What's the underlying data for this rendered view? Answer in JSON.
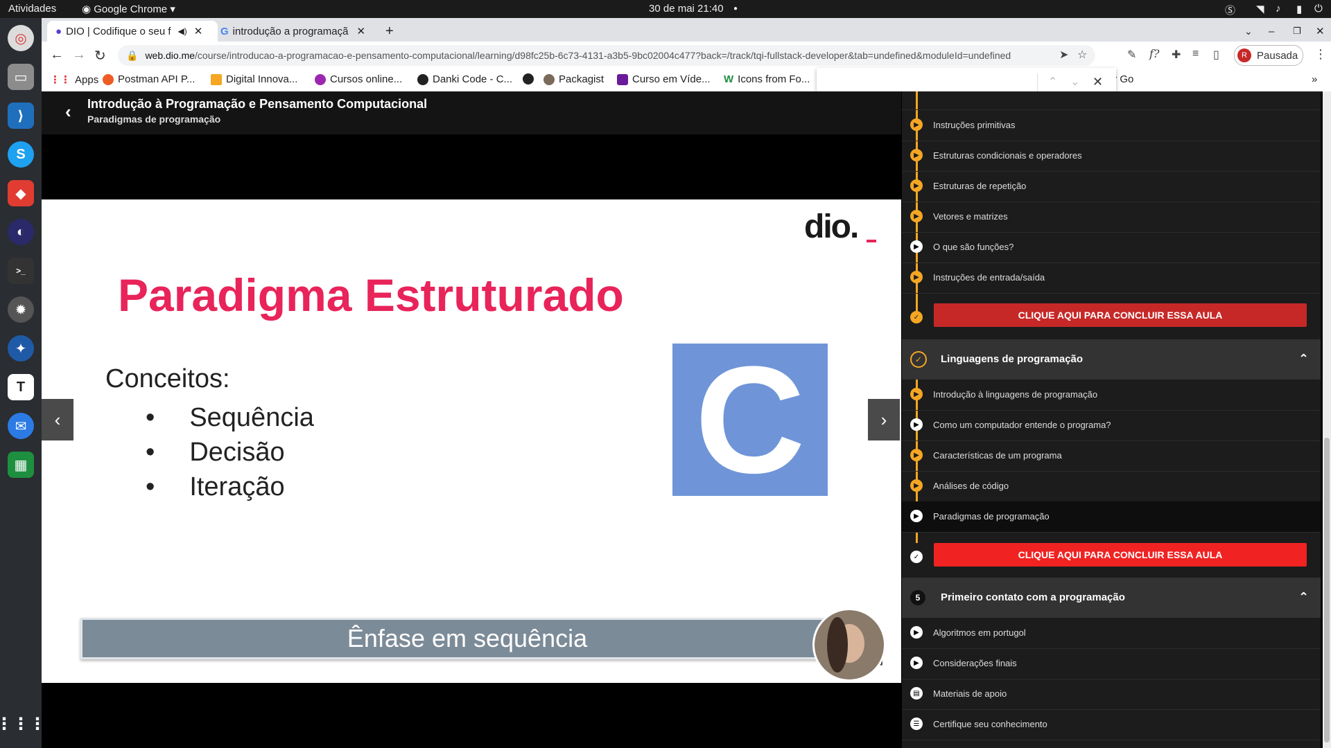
{
  "system": {
    "activities": "Atividades",
    "app_name": "Google Chrome",
    "datetime": "30 de mai  21:40"
  },
  "browser": {
    "tabs": [
      {
        "label": "DIO | Codifique o seu f"
      },
      {
        "label": "introdução a programaçã"
      }
    ],
    "url_domain": "web.dio.me",
    "url_path": "/course/introducao-a-programacao-e-pensamento-computacional/learning/d98fc25b-6c73-4131-a3b5-9bc02004c477?back=/track/tqi-fullstack-developer&tab=undefined&moduleId=undefined",
    "profile_label": "Pausada",
    "profile_initial": "R",
    "bookmarks": [
      "Apps",
      "Postman API P...",
      "Digital Innova...",
      "Cursos online...",
      "Danki Code - C...",
      "Packagist",
      "Curso em Víde...",
      "Icons from Fo...",
      "Um tour por Go"
    ]
  },
  "lesson": {
    "title": "Introdução à Programação e Pensamento Computacional",
    "subtitle": "Paradigmas de programação"
  },
  "slide": {
    "logo": "dio.",
    "heading": "Paradigma Estruturado",
    "concepts_label": "Conceitos:",
    "bullets": [
      "Sequência",
      "Decisão",
      "Iteração"
    ],
    "c_logo": "C",
    "banner": "Ênfase em sequência",
    "ref": "2]"
  },
  "sidebar": {
    "items_top": [
      {
        "label": "Instruções primitivas",
        "state": "done"
      },
      {
        "label": "Estruturas condicionais e operadores",
        "state": "done"
      },
      {
        "label": "Estruturas de repetição",
        "state": "done"
      },
      {
        "label": "Vetores e matrizes",
        "state": "done"
      },
      {
        "label": "O que são funções?",
        "state": "pending"
      },
      {
        "label": "Instruções de entrada/saída",
        "state": "done"
      }
    ],
    "cta_label": "CLIQUE AQUI PARA CONCLUIR ESSA AULA",
    "section2": {
      "title": "Linguagens de programação"
    },
    "items_section2": [
      {
        "label": "Introdução à linguagens de programação",
        "state": "done"
      },
      {
        "label": "Como um computador entende o programa?",
        "state": "pending"
      },
      {
        "label": "Características de um programa",
        "state": "done"
      },
      {
        "label": "Análises de código",
        "state": "done"
      },
      {
        "label": "Paradigmas de programação",
        "state": "current"
      }
    ],
    "section3": {
      "number": "5",
      "title": "Primeiro contato com a programação"
    },
    "items_section3": [
      {
        "label": "Algoritmos em portugol"
      },
      {
        "label": "Considerações finais"
      },
      {
        "label": "Materiais de apoio"
      },
      {
        "label": "Certifique seu conhecimento"
      }
    ]
  },
  "colors": {
    "accent": "#f5a623",
    "cta_done": "#c62828",
    "cta_active": "#f02222",
    "slide_title": "#e8245a",
    "c_logo_bg": "#6f95d8"
  }
}
